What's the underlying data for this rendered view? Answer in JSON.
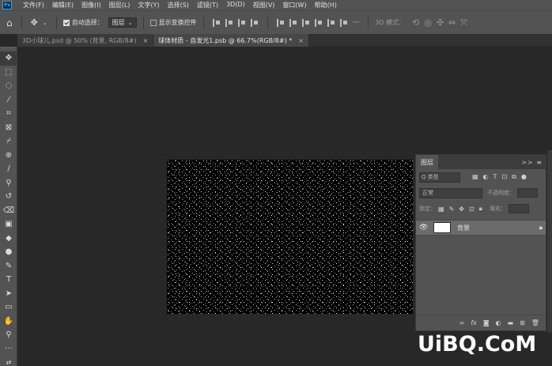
{
  "menubar": {
    "logo": "Ps",
    "items": [
      "文件(F)",
      "编辑(E)",
      "图像(I)",
      "图层(L)",
      "文字(Y)",
      "选择(S)",
      "滤镜(T)",
      "3D(D)",
      "视图(V)",
      "窗口(W)",
      "帮助(H)"
    ]
  },
  "options": {
    "auto_select_label": "自动选择：",
    "auto_select_target": "图层",
    "show_transform_label": "显示变换控件",
    "mode_3d_label": "3D 模式："
  },
  "tabs": [
    {
      "label": "3D小球儿.psd @ 50% (背景, RGB/8#)",
      "close": "×"
    },
    {
      "label": "球体材质 - 自发光1.psb @ 66.7%(RGB/8#) *",
      "close": "×"
    }
  ],
  "layers_panel": {
    "title": "图层",
    "header_controls": ">>  ≡",
    "kind_placeholder": "Q 类型",
    "blend_mode": "正常",
    "opacity_label": "不透明度：",
    "lock_label": "锁定：",
    "fill_label": "填充：",
    "layers": [
      {
        "name": "背景",
        "visible": true,
        "locked": true
      }
    ]
  },
  "watermark": "UiBQ.CoM",
  "colors": {
    "menubar_bg": "#535353",
    "canvas_bg": "#282828",
    "document_bg": "#000000",
    "accent": "#31a8ff"
  }
}
